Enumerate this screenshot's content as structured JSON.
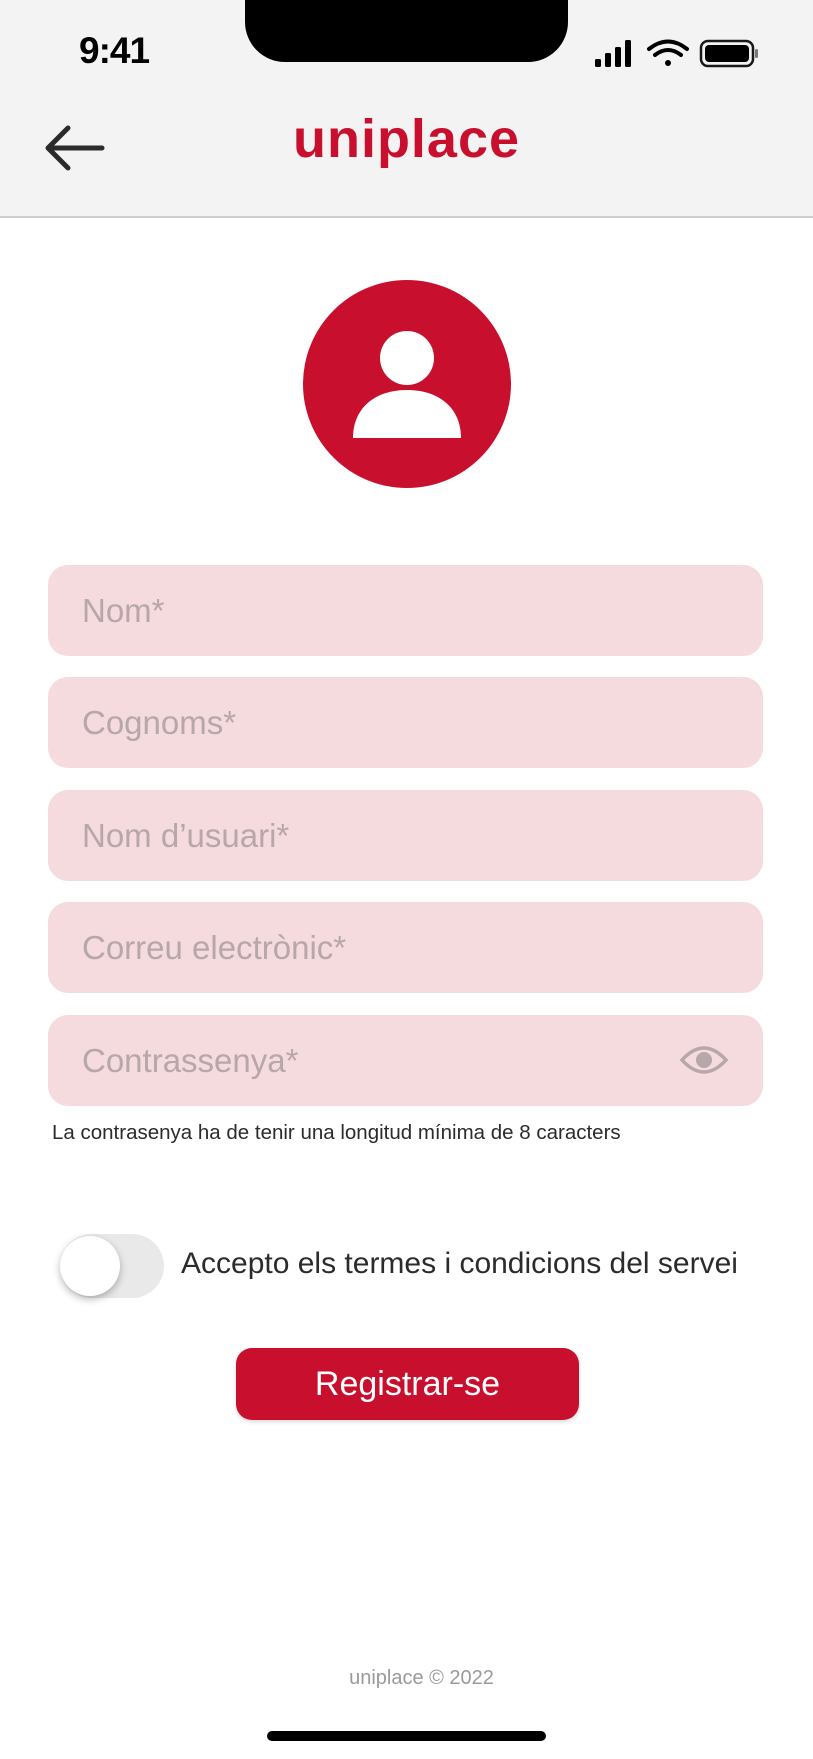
{
  "status_bar": {
    "time": "9:41",
    "icons": [
      "signal-icon",
      "wifi-icon",
      "battery-icon"
    ]
  },
  "header": {
    "back_icon": "arrow-left-icon",
    "brand": "uniplace",
    "brand_color": "#c8102e"
  },
  "avatar": {
    "icon": "user-icon"
  },
  "form": {
    "fields": [
      {
        "placeholder": "Nom*",
        "value": ""
      },
      {
        "placeholder": "Cognoms*",
        "value": ""
      },
      {
        "placeholder": "Nom d’usuari*",
        "value": ""
      },
      {
        "placeholder": "Correu electrònic*",
        "value": ""
      },
      {
        "placeholder": "Contrassenya*",
        "value": "",
        "icon": "eye-icon"
      }
    ],
    "password_hint": "La contrasenya ha de tenir una longitud mínima de 8 caracters",
    "terms_label": "Accepto els termes i condicions del servei",
    "terms_accepted": false,
    "submit_label": "Registrar-se"
  },
  "footer": {
    "text": "uniplace © 2022"
  },
  "colors": {
    "accent": "#c8102e",
    "field_bg": "#f5dade"
  }
}
